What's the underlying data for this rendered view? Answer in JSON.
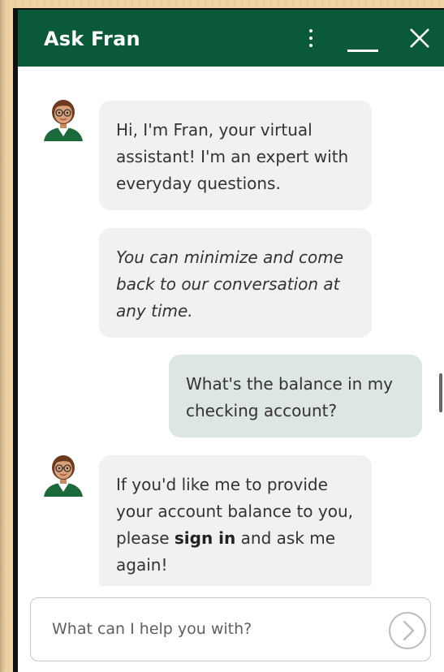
{
  "header": {
    "title": "Ask Fran",
    "menu_icon": "more-vertical-icon",
    "minimize_icon": "minimize-icon",
    "close_icon": "close-icon",
    "background_color": "#0a5a3a"
  },
  "messages": [
    {
      "from": "bot",
      "text": "Hi, I'm Fran, your virtual assistant! I'm an expert with everyday questions."
    },
    {
      "from": "bot",
      "text": "You can minimize and come back to our conversation at any time."
    },
    {
      "from": "user",
      "text": "What's the balance in my checking account?"
    },
    {
      "from": "bot",
      "text_before": "If you'd like me to provide your account balance to you, please ",
      "link": "sign in",
      "text_after": " and ask me again!"
    }
  ],
  "composer": {
    "placeholder": "What can I help you with?",
    "send_icon": "send-arrow-icon"
  },
  "colors": {
    "bot_bubble": "#f1f1f1",
    "user_bubble": "#dde6e4"
  }
}
